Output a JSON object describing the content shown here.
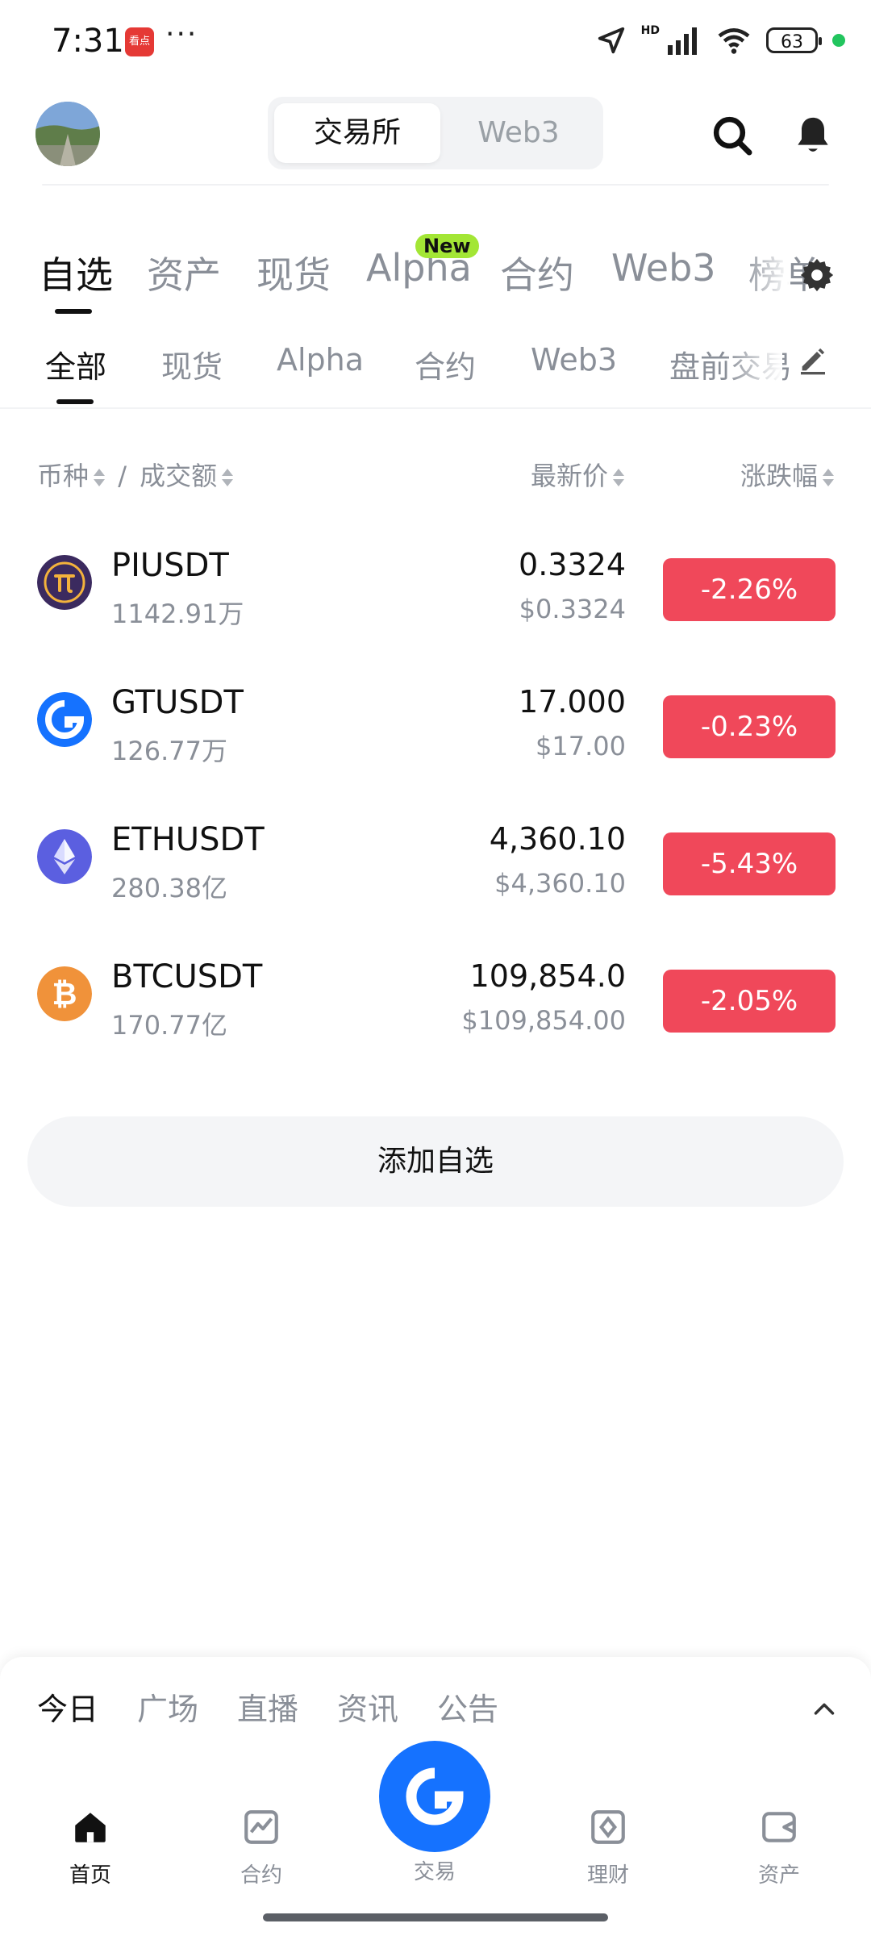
{
  "status_bar": {
    "time": "7:31",
    "app_badge": "看点",
    "more": "···",
    "network_label": "HD",
    "battery": "63"
  },
  "header": {
    "mode_tabs": [
      {
        "label": "交易所",
        "active": true
      },
      {
        "label": "Web3",
        "active": false
      }
    ]
  },
  "primary_tabs": [
    {
      "label": "自选",
      "active": true
    },
    {
      "label": "资产",
      "active": false
    },
    {
      "label": "现货",
      "active": false
    },
    {
      "label": "Alpha",
      "active": false,
      "badge": "New"
    },
    {
      "label": "合约",
      "active": false
    },
    {
      "label": "Web3",
      "active": false
    },
    {
      "label": "榜单",
      "active": false
    }
  ],
  "secondary_tabs": [
    {
      "label": "全部",
      "active": true
    },
    {
      "label": "现货",
      "active": false
    },
    {
      "label": "Alpha",
      "active": false
    },
    {
      "label": "合约",
      "active": false
    },
    {
      "label": "Web3",
      "active": false
    },
    {
      "label": "盘前交易",
      "active": false
    }
  ],
  "columns": {
    "coin": "币种",
    "separator": "/",
    "volume": "成交额",
    "price": "最新价",
    "change": "涨跌幅"
  },
  "rows": [
    {
      "symbol": "PIUSDT",
      "volume": "1142.91万",
      "price": "0.3324",
      "price_usd": "$0.3324",
      "change": "-2.26%",
      "icon": "pi-coin-icon",
      "color": "#3b2a5f"
    },
    {
      "symbol": "GTUSDT",
      "volume": "126.77万",
      "price": "17.000",
      "price_usd": "$17.00",
      "change": "-0.23%",
      "icon": "gt-coin-icon",
      "color": "#1572ff"
    },
    {
      "symbol": "ETHUSDT",
      "volume": "280.38亿",
      "price": "4,360.10",
      "price_usd": "$4,360.10",
      "change": "-5.43%",
      "icon": "eth-coin-icon",
      "color": "#5b5fe0"
    },
    {
      "symbol": "BTCUSDT",
      "volume": "170.77亿",
      "price": "109,854.0",
      "price_usd": "$109,854.00",
      "change": "-2.05%",
      "icon": "btc-coin-icon",
      "color": "#f0923a"
    }
  ],
  "add_button": "添加自选",
  "news_tabs": [
    {
      "label": "今日",
      "active": true
    },
    {
      "label": "广场",
      "active": false
    },
    {
      "label": "直播",
      "active": false
    },
    {
      "label": "资讯",
      "active": false
    },
    {
      "label": "公告",
      "active": false
    }
  ],
  "bottom_nav": [
    {
      "label": "首页",
      "active": true,
      "icon": "home-icon"
    },
    {
      "label": "合约",
      "active": false,
      "icon": "futures-chart-icon"
    },
    {
      "label": "交易",
      "active": false,
      "icon": "trade-logo-icon"
    },
    {
      "label": "理财",
      "active": false,
      "icon": "finance-icon"
    },
    {
      "label": "资产",
      "active": false,
      "icon": "wallet-icon"
    }
  ],
  "colors": {
    "negative": "#f0485a",
    "brand_blue": "#1572ff",
    "new_badge": "#a3e635"
  }
}
